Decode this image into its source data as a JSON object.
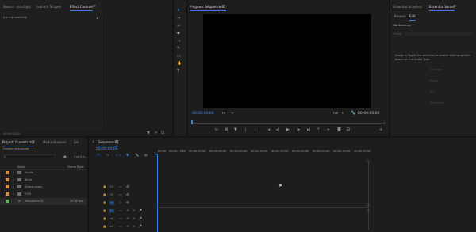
{
  "colors": {
    "bg": "#1d1d1d",
    "panel": "#232323",
    "accent_blue": "#3a7fd5",
    "timecode_blue": "#4b8fe6",
    "monitor_black": "#000000",
    "swatch_orange": "#e0903a",
    "swatch_green": "#5fb05a"
  },
  "source_panel": {
    "tabs": [
      "Source: (no clips)",
      "Lumetri Scopes",
      "Effect Controls"
    ],
    "active_tab": "Effect Controls",
    "menu_icon": "hamburger-menu-icon",
    "clip_label": "(no clip selected)",
    "timecode": "00:00:00:00"
  },
  "tools": [
    "select-tool-icon",
    "track-select-icon",
    "ripple-edit-icon",
    "razor-icon",
    "slip-icon",
    "pen-icon",
    "rectangle-icon",
    "hand-icon",
    "type-icon"
  ],
  "program_monitor": {
    "tab": "Program: Sequence 01",
    "timecode_left": "00:00:00:00",
    "zoom": "Fit",
    "quality": "Full",
    "timecode_right": "00:00:00:00",
    "transport": [
      "mark-in-icon",
      "mark-out-icon",
      "add-marker-icon",
      "go-to-in-icon",
      "step-back-icon",
      "play-icon",
      "step-forward-icon",
      "go-to-out-icon",
      "lift-icon",
      "extract-icon",
      "export-frame-icon",
      "compare-icon"
    ]
  },
  "essential_panel": {
    "tabs": [
      "Essential Graphics",
      "Essential Sound"
    ],
    "active_tab": "Essential Sound",
    "subtabs": [
      "Browse",
      "Edit"
    ],
    "active_subtab": "Edit",
    "selection": "No Selection",
    "preset_label": "Preset",
    "message": "Assign a Tag to the selection to enable editing options based on the Audio Type.",
    "types": [
      "Dialogue",
      "Music",
      "SFX",
      "Ambience"
    ]
  },
  "project_panel": {
    "tabs": [
      "Project: Dunelm trip",
      "Media Browser",
      "Lib"
    ],
    "active_tab": "Project: Dunelm trip",
    "project_file": "Dunelm trip.prproj",
    "items_count": "1 of 5 it...",
    "col_name": "Name",
    "col_framerate": "Frame Rate",
    "items": [
      {
        "name": "Audio",
        "type": "folder",
        "color": "#e0903a",
        "rate": ""
      },
      {
        "name": "Brief",
        "type": "folder",
        "color": "#e0903a",
        "rate": ""
      },
      {
        "name": "Drone shots",
        "type": "folder",
        "color": "#e0903a",
        "rate": ""
      },
      {
        "name": "GFX",
        "type": "folder",
        "color": "#e0903a",
        "rate": ""
      },
      {
        "name": "Sequence 01",
        "type": "sequence",
        "color": "#5fb05a",
        "rate": "25.00 fps"
      }
    ]
  },
  "timeline": {
    "tab": "Sequence 01",
    "timecode": "00:00:00:00",
    "ruler": [
      "00:00",
      "00:00:15:00",
      "00:00:30:00",
      "00:00:45:00",
      "00:01:00:00",
      "00:01:15:00",
      "00:01:30:00",
      "00:01:45:00",
      "00:02:00:00",
      "00:02:15:00",
      "00:02:30:00",
      "00:02:4"
    ],
    "video_tracks": [
      "V3",
      "V2",
      "V1"
    ],
    "audio_tracks": [
      "A1",
      "A2",
      "A3"
    ],
    "track_letters": [
      "M",
      "S"
    ]
  }
}
